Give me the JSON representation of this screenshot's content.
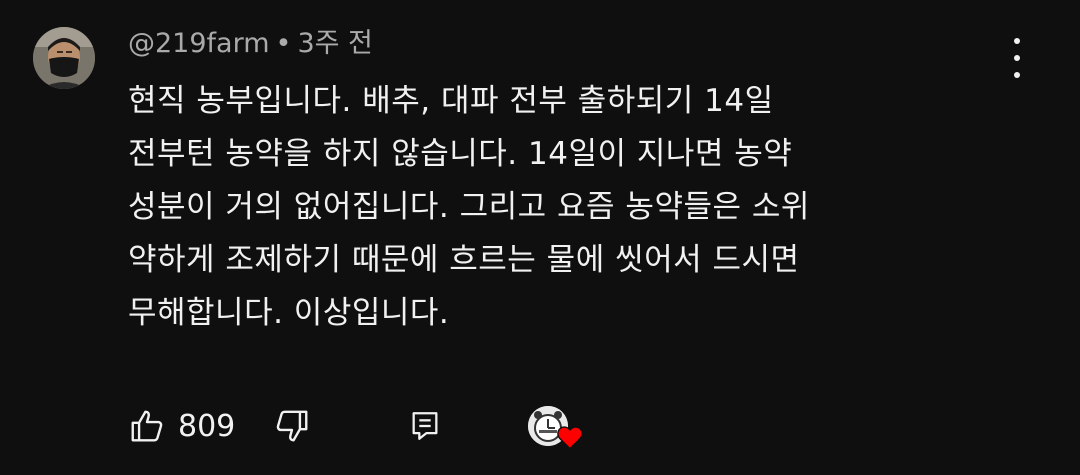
{
  "comment": {
    "author": "@219farm",
    "separator": "•",
    "timestamp": "3주 전",
    "lines": [
      "현직 농부입니다. 배추, 대파 전부 출하되기 14일",
      "전부턴 농약을 하지 않습니다. 14일이 지나면 농약",
      "성분이 거의 없어집니다. 그리고 요즘 농약들은 소위",
      "약하게 조제하기 때문에 흐르는 물에 씻어서 드시면",
      "무해합니다. 이상입니다."
    ],
    "like_count": "809"
  },
  "icons": {
    "like": "thumbs-up-icon",
    "dislike": "thumbs-down-icon",
    "reply": "reply-comment-icon",
    "menu": "more-vert-icon",
    "creator_heart": "creator-heart-icon"
  },
  "colors": {
    "background": "#0f0f0f",
    "text": "#f1f1f1",
    "meta": "#aaaaaa",
    "heart": "#ff0000"
  }
}
